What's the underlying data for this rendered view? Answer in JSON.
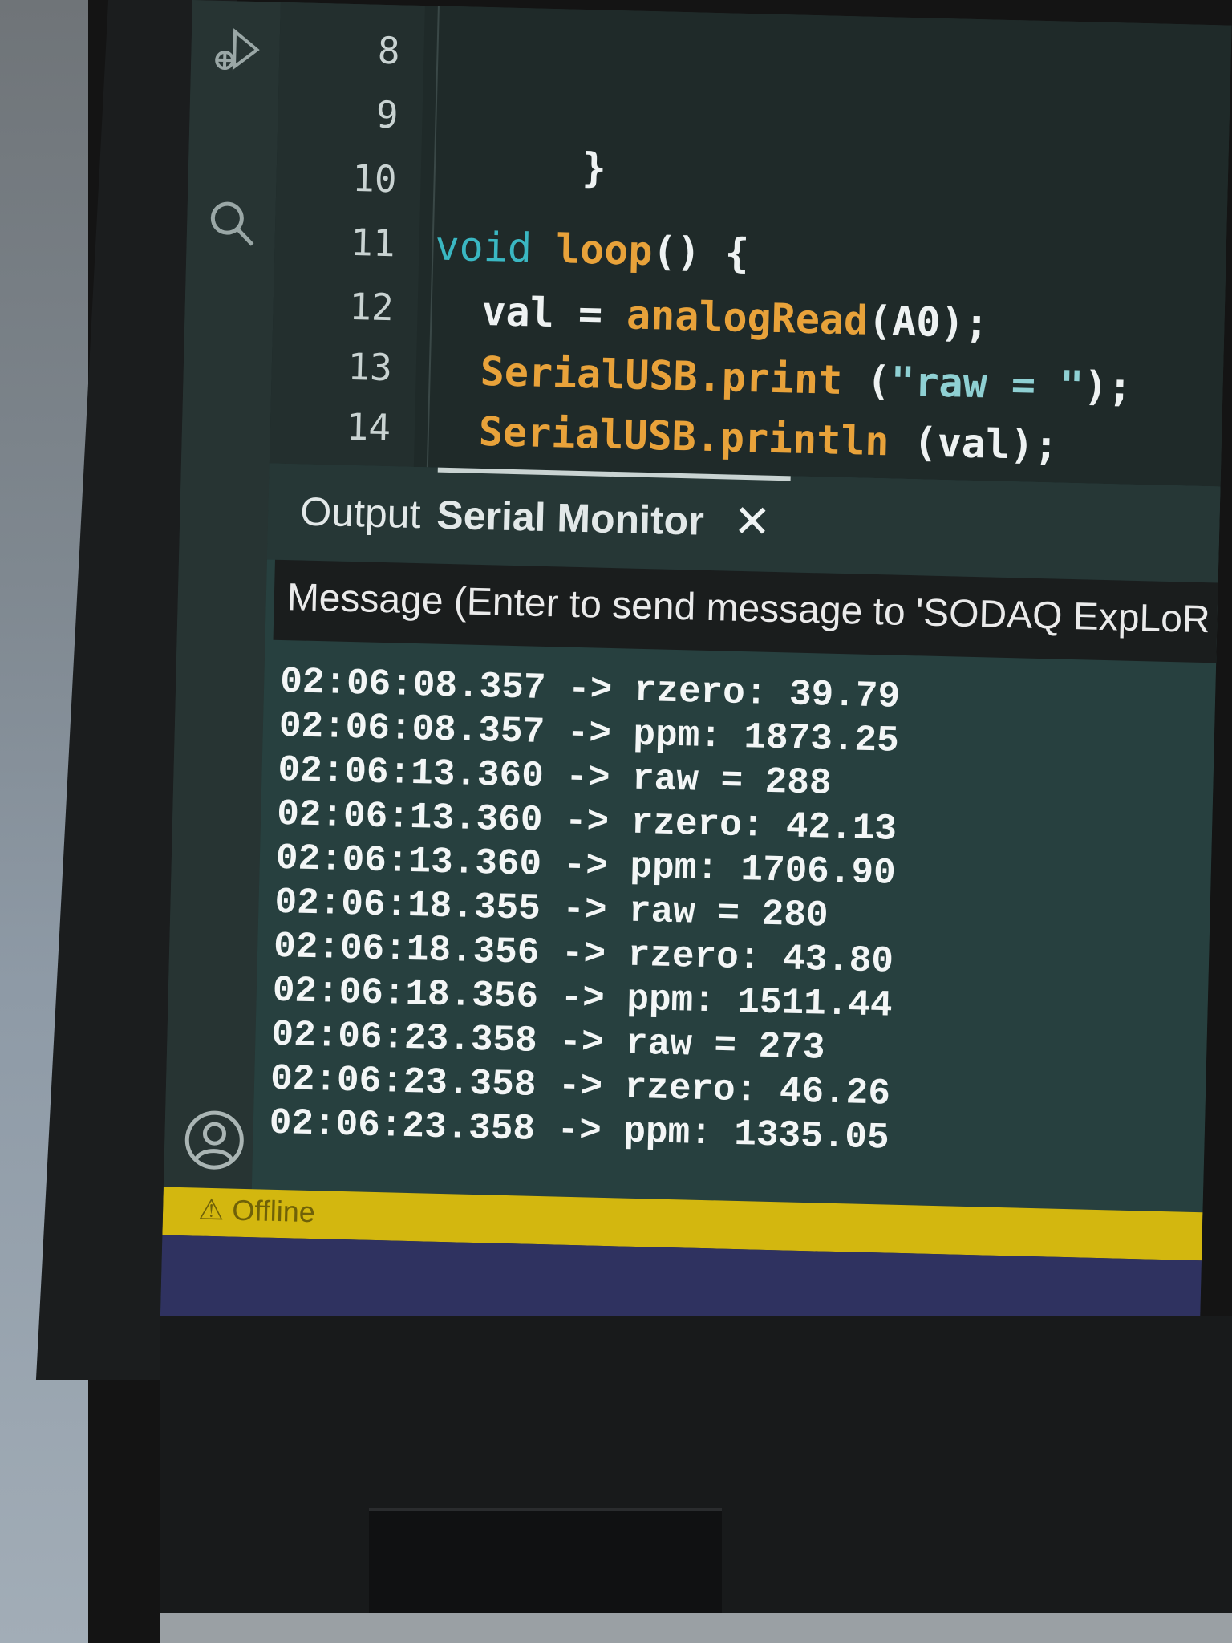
{
  "editor": {
    "line_numbers": [
      "8",
      "9",
      "10",
      "11",
      "12",
      "13",
      "14"
    ],
    "code": {
      "line9_brace": "}",
      "line11_keyword": "void",
      "line11_name": "loop",
      "line11_rest": "() {",
      "line12_var": "val = ",
      "line12_fn": "analogRead",
      "line12_rest": "(A0);",
      "line13_obj": "SerialUSB.print",
      "line13_paren": " (",
      "line13_str": "\"raw = \"",
      "line13_rest": ");",
      "line14_obj": "SerialUSB.println",
      "line14_rest": " (val);"
    }
  },
  "panel": {
    "tabs": [
      {
        "label": "Output"
      },
      {
        "label": "Serial Monitor"
      }
    ],
    "close_glyph": "✕",
    "message_placeholder": "Message (Enter to send message to 'SODAQ ExpLoR",
    "log": [
      "02:06:08.357 -> rzero: 39.79",
      "02:06:08.357 -> ppm: 1873.25",
      "02:06:13.360 -> raw = 288",
      "02:06:13.360 -> rzero: 42.13",
      "02:06:13.360 -> ppm: 1706.90",
      "02:06:18.355 -> raw = 280",
      "02:06:18.356 -> rzero: 43.80",
      "02:06:18.356 -> ppm: 1511.44",
      "02:06:23.358 -> raw = 273",
      "02:06:23.358 -> rzero: 46.26",
      "02:06:23.358 -> ppm: 1335.05"
    ]
  },
  "status_bar": {
    "warning_glyph": "⚠",
    "label": "Offline"
  },
  "icons": {
    "activity_bar": [
      "debug-icon",
      "search-icon"
    ],
    "account": "account-icon"
  },
  "colors": {
    "status_bar": "#d3b70f",
    "keyword": "#3ab7c2",
    "function": "#e8a23a"
  }
}
